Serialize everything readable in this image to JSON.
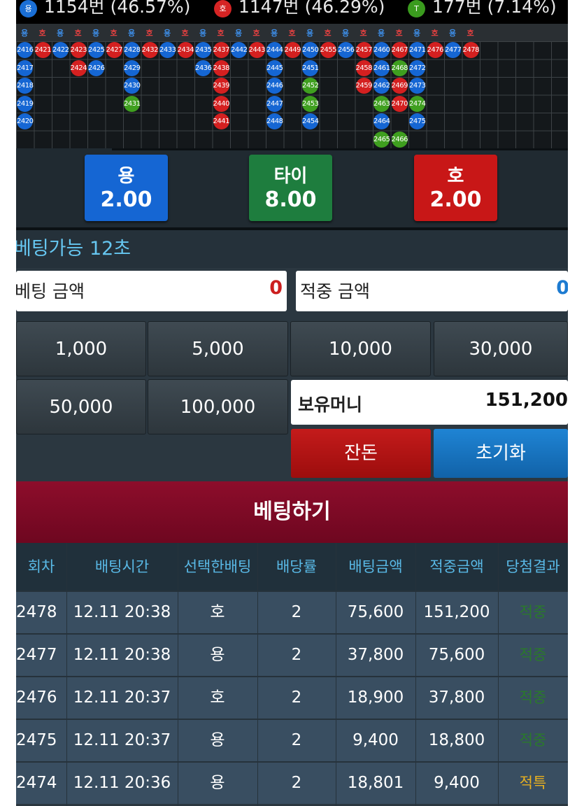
{
  "stats": [
    {
      "badge": "용",
      "text": "1154번 (46.57%)",
      "color": "#1a6fd6"
    },
    {
      "badge": "호",
      "text": "1147번 (46.29%)",
      "color": "#d62424"
    },
    {
      "badge": "T",
      "text": "177번 (7.14%)",
      "color": "#3a9b1e"
    }
  ],
  "colors": {
    "dragon": "#1566d3",
    "tiger": "#d42020",
    "tie": "#3f9f1f",
    "bet_red": "#cc1f1f",
    "bet_blue": "#1d7bd1"
  },
  "road": {
    "header_labels": [
      "용",
      "호",
      "용",
      "호",
      "용",
      "호",
      "용",
      "호",
      "용",
      "호",
      "용",
      "호",
      "용",
      "호",
      "용",
      "호",
      "용",
      "호",
      "용",
      "호",
      "용",
      "호",
      "용",
      "호",
      "용",
      "호"
    ],
    "cells": [
      {
        "n": "2416",
        "t": "d",
        "c": 0,
        "r": 0
      },
      {
        "n": "2417",
        "t": "d",
        "c": 0,
        "r": 1
      },
      {
        "n": "2418",
        "t": "d",
        "c": 0,
        "r": 2
      },
      {
        "n": "2419",
        "t": "d",
        "c": 0,
        "r": 3
      },
      {
        "n": "2420",
        "t": "d",
        "c": 0,
        "r": 4
      },
      {
        "n": "2421",
        "t": "t",
        "c": 1,
        "r": 0
      },
      {
        "n": "2422",
        "t": "d",
        "c": 2,
        "r": 0
      },
      {
        "n": "2423",
        "t": "t",
        "c": 3,
        "r": 0
      },
      {
        "n": "2424",
        "t": "t",
        "c": 3,
        "r": 1
      },
      {
        "n": "2425",
        "t": "d",
        "c": 4,
        "r": 0
      },
      {
        "n": "2426",
        "t": "d",
        "c": 4,
        "r": 1
      },
      {
        "n": "2427",
        "t": "t",
        "c": 5,
        "r": 0
      },
      {
        "n": "2428",
        "t": "d",
        "c": 6,
        "r": 0
      },
      {
        "n": "2429",
        "t": "d",
        "c": 6,
        "r": 1
      },
      {
        "n": "2430",
        "t": "d",
        "c": 6,
        "r": 2
      },
      {
        "n": "2431",
        "t": "x",
        "c": 6,
        "r": 3
      },
      {
        "n": "2432",
        "t": "t",
        "c": 7,
        "r": 0
      },
      {
        "n": "2433",
        "t": "d",
        "c": 8,
        "r": 0
      },
      {
        "n": "2434",
        "t": "t",
        "c": 9,
        "r": 0
      },
      {
        "n": "2435",
        "t": "d",
        "c": 10,
        "r": 0
      },
      {
        "n": "2436",
        "t": "d",
        "c": 10,
        "r": 1
      },
      {
        "n": "2437",
        "t": "t",
        "c": 11,
        "r": 0
      },
      {
        "n": "2438",
        "t": "t",
        "c": 11,
        "r": 1
      },
      {
        "n": "2439",
        "t": "t",
        "c": 11,
        "r": 2
      },
      {
        "n": "2440",
        "t": "t",
        "c": 11,
        "r": 3
      },
      {
        "n": "2441",
        "t": "t",
        "c": 11,
        "r": 4
      },
      {
        "n": "2442",
        "t": "d",
        "c": 12,
        "r": 0
      },
      {
        "n": "2443",
        "t": "t",
        "c": 13,
        "r": 0
      },
      {
        "n": "2444",
        "t": "d",
        "c": 14,
        "r": 0
      },
      {
        "n": "2445",
        "t": "d",
        "c": 14,
        "r": 1
      },
      {
        "n": "2446",
        "t": "d",
        "c": 14,
        "r": 2
      },
      {
        "n": "2447",
        "t": "d",
        "c": 14,
        "r": 3
      },
      {
        "n": "2448",
        "t": "d",
        "c": 14,
        "r": 4
      },
      {
        "n": "2449",
        "t": "t",
        "c": 15,
        "r": 0
      },
      {
        "n": "2450",
        "t": "d",
        "c": 16,
        "r": 0
      },
      {
        "n": "2451",
        "t": "d",
        "c": 16,
        "r": 1
      },
      {
        "n": "2452",
        "t": "x",
        "c": 16,
        "r": 2
      },
      {
        "n": "2453",
        "t": "x",
        "c": 16,
        "r": 3
      },
      {
        "n": "2454",
        "t": "d",
        "c": 16,
        "r": 4
      },
      {
        "n": "2455",
        "t": "t",
        "c": 17,
        "r": 0
      },
      {
        "n": "2456",
        "t": "d",
        "c": 18,
        "r": 0
      },
      {
        "n": "2457",
        "t": "t",
        "c": 19,
        "r": 0
      },
      {
        "n": "2458",
        "t": "t",
        "c": 19,
        "r": 1
      },
      {
        "n": "2459",
        "t": "t",
        "c": 19,
        "r": 2
      },
      {
        "n": "2460",
        "t": "d",
        "c": 20,
        "r": 0
      },
      {
        "n": "2461",
        "t": "d",
        "c": 20,
        "r": 1
      },
      {
        "n": "2462",
        "t": "d",
        "c": 20,
        "r": 2
      },
      {
        "n": "2463",
        "t": "x",
        "c": 20,
        "r": 3
      },
      {
        "n": "2464",
        "t": "d",
        "c": 20,
        "r": 4
      },
      {
        "n": "2465",
        "t": "x",
        "c": 20,
        "r": 5
      },
      {
        "n": "2466",
        "t": "x",
        "c": 21,
        "r": 5
      },
      {
        "n": "2467",
        "t": "t",
        "c": 21,
        "r": 0
      },
      {
        "n": "2468",
        "t": "x",
        "c": 21,
        "r": 1
      },
      {
        "n": "2469",
        "t": "t",
        "c": 21,
        "r": 2
      },
      {
        "n": "2470",
        "t": "t",
        "c": 21,
        "r": 3
      },
      {
        "n": "2471",
        "t": "d",
        "c": 22,
        "r": 0
      },
      {
        "n": "2472",
        "t": "d",
        "c": 22,
        "r": 1
      },
      {
        "n": "2473",
        "t": "d",
        "c": 22,
        "r": 2
      },
      {
        "n": "2474",
        "t": "x",
        "c": 22,
        "r": 3
      },
      {
        "n": "2475",
        "t": "d",
        "c": 22,
        "r": 4
      },
      {
        "n": "2476",
        "t": "t",
        "c": 23,
        "r": 0
      },
      {
        "n": "2477",
        "t": "d",
        "c": 24,
        "r": 0
      },
      {
        "n": "2478",
        "t": "t",
        "c": 25,
        "r": 0
      }
    ]
  },
  "odds": [
    {
      "name": "용",
      "value": "2.00",
      "color": "#1566d3"
    },
    {
      "name": "타이",
      "value": "8.00",
      "color": "#1e7d3e"
    },
    {
      "name": "호",
      "value": "2.00",
      "color": "#c81717"
    }
  ],
  "timer": "베팅가능 12초",
  "bet_amount": {
    "label": "베팅 금액",
    "value": "0"
  },
  "win_amount": {
    "label": "적중 금액",
    "value": "0"
  },
  "chips": [
    "1,000",
    "5,000",
    "10,000",
    "30,000",
    "50,000",
    "100,000"
  ],
  "money": {
    "label": "보유머니",
    "value": "151,200"
  },
  "actions": {
    "change": "잔돈",
    "reset": "초기화"
  },
  "bet_button": "베팅하기",
  "table": {
    "headers": [
      "회차",
      "배팅시간",
      "선택한배팅",
      "배당률",
      "배팅금액",
      "적중금액",
      "당첨결과"
    ],
    "rows": [
      [
        "2478",
        "12.11 20:38",
        "호",
        "2",
        "75,600",
        "151,200",
        "적중"
      ],
      [
        "2477",
        "12.11 20:38",
        "용",
        "2",
        "37,800",
        "75,600",
        "적중"
      ],
      [
        "2476",
        "12.11 20:37",
        "호",
        "2",
        "18,900",
        "37,800",
        "적중"
      ],
      [
        "2475",
        "12.11 20:37",
        "용",
        "2",
        "9,400",
        "18,800",
        "적중"
      ],
      [
        "2474",
        "12.11 20:36",
        "용",
        "2",
        "18,801",
        "9,400",
        "적특"
      ]
    ],
    "result_colors": {
      "적중": "#2a7a2a",
      "적특": "#e8b020"
    }
  }
}
